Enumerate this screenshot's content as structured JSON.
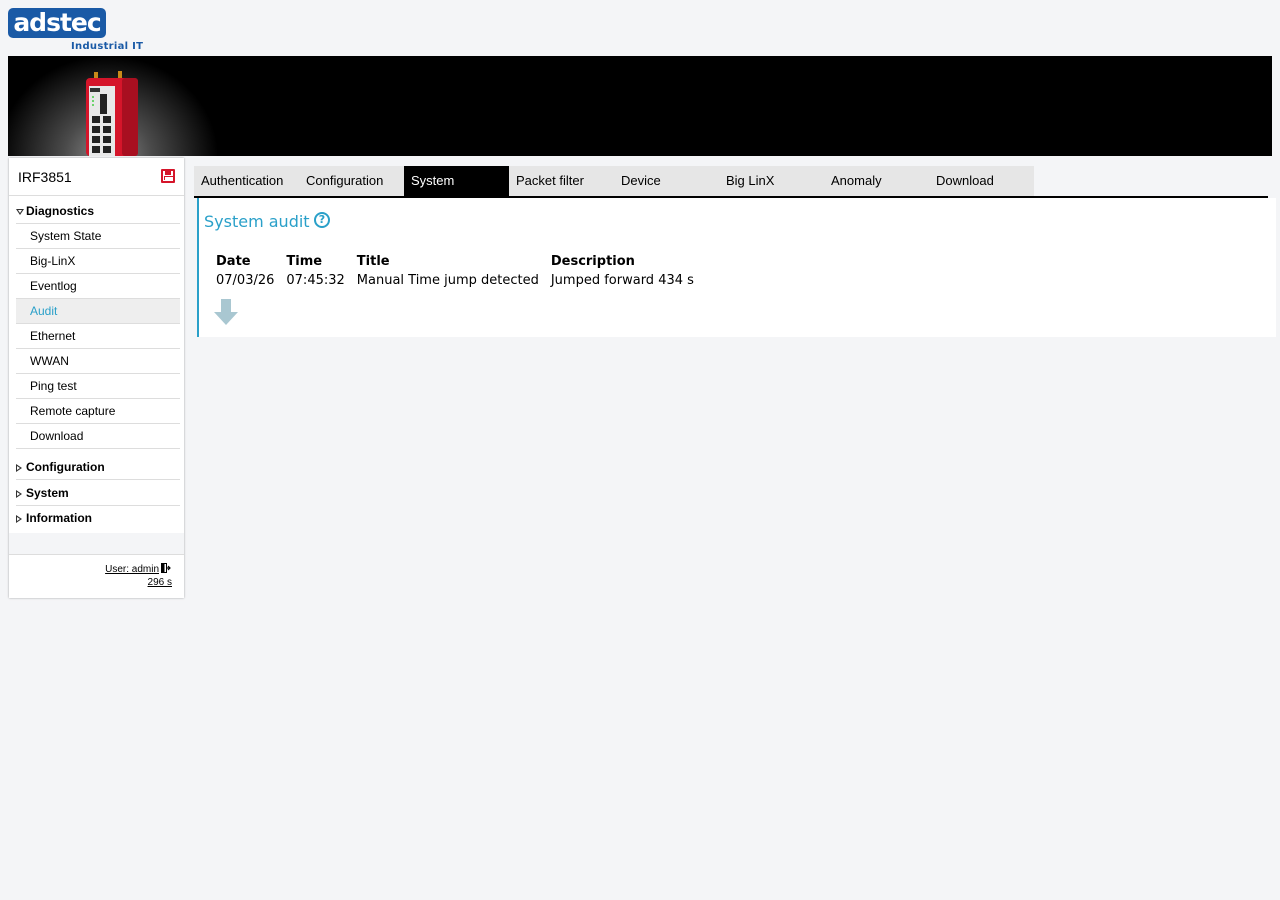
{
  "logo": {
    "brand": "adstec",
    "tagline": "Industrial IT"
  },
  "sidebar": {
    "device_name": "IRF3851",
    "groups": [
      {
        "label": "Diagnostics",
        "expanded": true
      },
      {
        "label": "Configuration",
        "expanded": false
      },
      {
        "label": "System",
        "expanded": false
      },
      {
        "label": "Information",
        "expanded": false
      }
    ],
    "diagnostics_items": [
      {
        "label": "System State"
      },
      {
        "label": "Big-LinX"
      },
      {
        "label": "Eventlog"
      },
      {
        "label": "Audit",
        "active": true
      },
      {
        "label": "Ethernet"
      },
      {
        "label": "WWAN"
      },
      {
        "label": "Ping test"
      },
      {
        "label": "Remote capture"
      },
      {
        "label": "Download"
      }
    ],
    "user": "User: admin",
    "session_timer": "296 s"
  },
  "tabs": [
    {
      "label": "Authentication"
    },
    {
      "label": "Configuration"
    },
    {
      "label": "System",
      "active": true
    },
    {
      "label": "Packet filter"
    },
    {
      "label": "Device"
    },
    {
      "label": "Big LinX"
    },
    {
      "label": "Anomaly"
    },
    {
      "label": "Download"
    }
  ],
  "main": {
    "title": "System audit",
    "table": {
      "headers": [
        "Date",
        "Time",
        "Title",
        "Description"
      ],
      "rows": [
        [
          "07/03/26",
          "07:45:32",
          "Manual Time jump detected",
          "Jumped forward 434 s"
        ]
      ]
    }
  },
  "colors": {
    "accent": "#2aa0c9",
    "brand": "#1a5aa6",
    "device_red": "#d5152a",
    "tab_bar": "#e6e6e6",
    "active_tab": "#000000",
    "download_arrow": "#a9c7d1"
  },
  "icons": {
    "save": "save-icon",
    "help": "help-icon",
    "logout": "logout-icon",
    "download": "download-arrow-icon"
  }
}
